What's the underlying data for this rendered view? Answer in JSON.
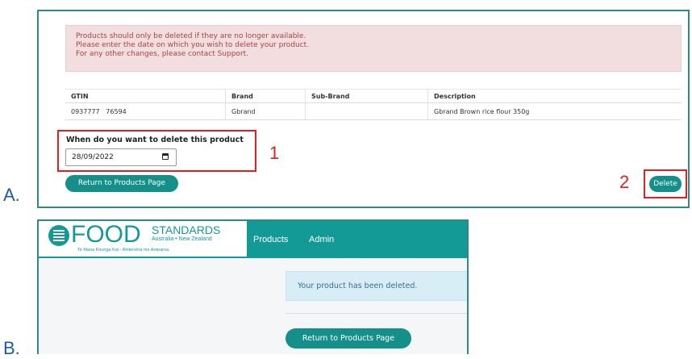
{
  "labels": {
    "a": "A.",
    "b": "B."
  },
  "panel_a": {
    "alert_lines": [
      "Products should only be deleted if they are no longer available.",
      "Please enter the date on which you wish to delete your product.",
      "For any other changes, please contact Support."
    ],
    "table": {
      "headers": [
        "GTIN",
        "Brand",
        "Sub-Brand",
        "Description"
      ],
      "row": [
        "0937777   76594",
        "Gbrand",
        "",
        "Gbrand Brown rice flour 350g"
      ]
    },
    "date_label": "When do you want to delete this product",
    "date_value": "28/09/2022",
    "return_label": "Return to Products Page",
    "delete_label": "Delete",
    "annotations": {
      "one": "1",
      "two": "2"
    },
    "annotation_color": "#e02020",
    "accent_color": "#148f8a"
  },
  "panel_b": {
    "logo": {
      "food": "FOOD",
      "standards": "STANDARDS",
      "region": "Australia • New Zealand",
      "maori": "Te Mana Kounga Kai - Ahitereiria me Aotearoa"
    },
    "nav": {
      "products": "Products",
      "admin": "Admin"
    },
    "success_message": "Your product has been deleted.",
    "return_label": "Return to Products Page",
    "nav_color": "#149a96"
  }
}
